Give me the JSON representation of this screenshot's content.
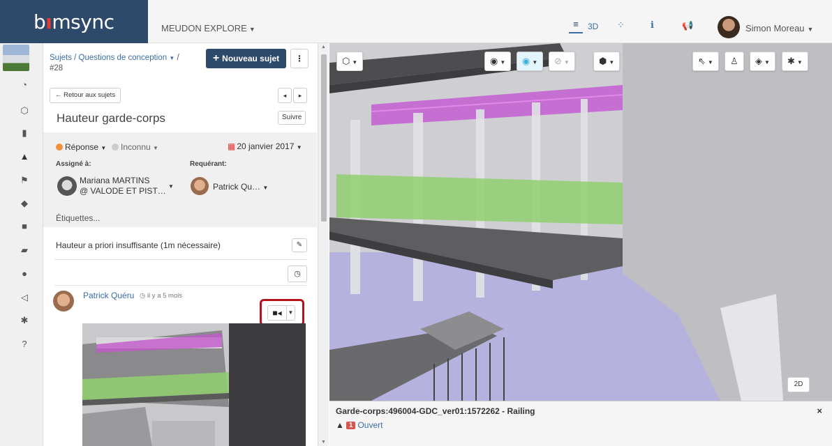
{
  "app": {
    "logo_prefix": "b",
    "logo_dot": "ı",
    "logo_suffix": "msync"
  },
  "header": {
    "project": "MEUDON EXPLORE",
    "nav_3d": "3D",
    "nav_info": "i",
    "user": "Simon Moreau"
  },
  "issue": {
    "breadcrumb": "Sujets / Questions de conception",
    "breadcrumb_sep": "/",
    "number": "#28",
    "new_button": "Nouveau sujet",
    "back_button": "Retour aux sujets",
    "title": "Hauteur garde-corps",
    "follow_button": "Suivre",
    "status": "Réponse",
    "priority": "Inconnu",
    "date": "20 janvier 2017",
    "assigned_label": "Assigné à:",
    "requester_label": "Requérant:",
    "assignee_line1": "Mariana MARTINS",
    "assignee_line2": "@ VALODE ET PIST…",
    "requester": "Patrick Qu…",
    "tags": "Étiquettes...",
    "description": "Hauteur a priori insuffisante (1m nécessaire)"
  },
  "comment": {
    "author": "Patrick Quéru",
    "time": "il y a 5 mois"
  },
  "viewer": {
    "btn_2d": "2D",
    "selection_name": "Garde-corps:496004-GDC_ver01:1572262 - Railing",
    "selection_count": "1",
    "selection_status": "Ouvert"
  },
  "colors": {
    "header_brand": "#2e4a6b",
    "accent": "#3b6ea5",
    "highlight_border": "#b5121b",
    "status_orange": "#f0913c",
    "badge_red": "#d9534f"
  }
}
